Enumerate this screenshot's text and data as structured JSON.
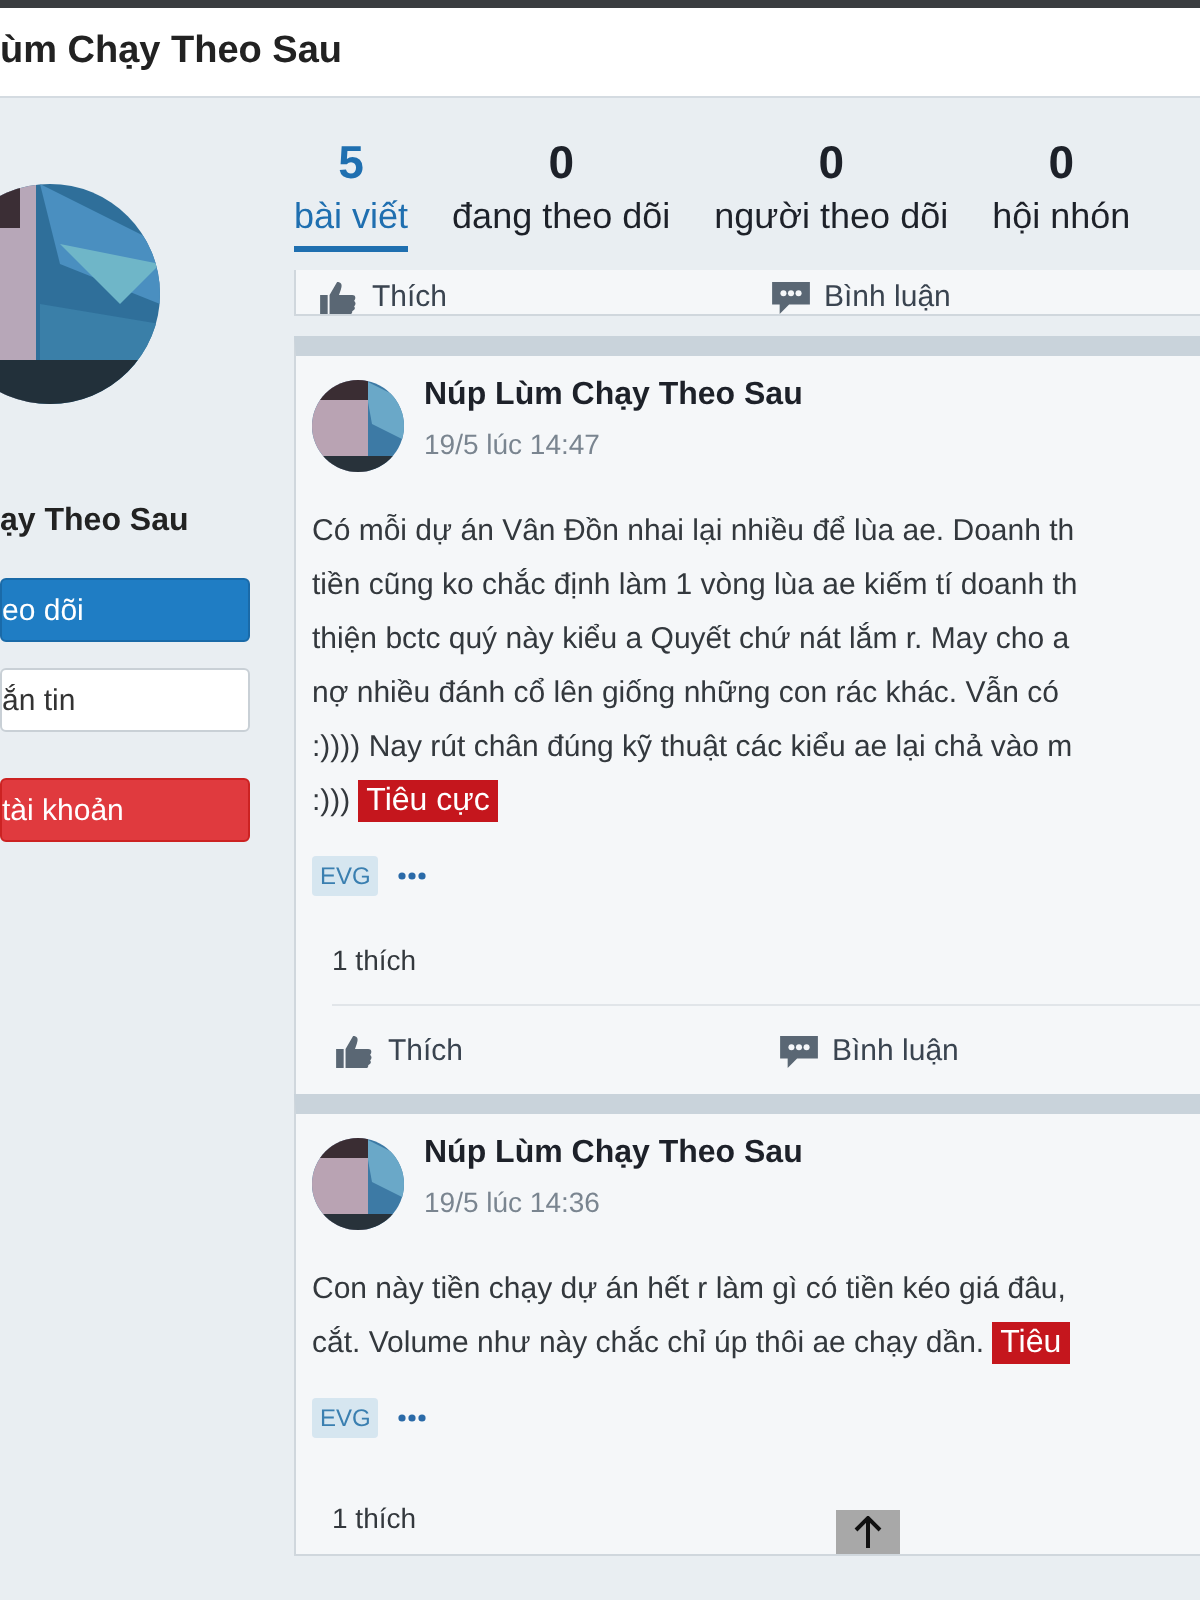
{
  "header": {
    "title": "ùm Chạy Theo Sau"
  },
  "profile": {
    "name": "ạy Theo Sau",
    "buttons": [
      {
        "label": "eo dõi",
        "kind": "primary"
      },
      {
        "label": "ắn tin",
        "kind": "default"
      },
      {
        "label": "tài khoản",
        "kind": "danger"
      }
    ]
  },
  "stats": [
    {
      "count": "5",
      "label": "bài viết",
      "selected": true
    },
    {
      "count": "0",
      "label": "đang theo dõi",
      "selected": false
    },
    {
      "count": "0",
      "label": "người theo dõi",
      "selected": false
    },
    {
      "count": "0",
      "label": "hội nhón",
      "selected": false
    }
  ],
  "partial_actions": [
    {
      "kind": "like",
      "label": "Thích"
    },
    {
      "kind": "comment",
      "label": "Bình luận"
    }
  ],
  "posts": [
    {
      "author": "Núp Lùm Chạy Theo Sau",
      "time": "19/5 lúc 14:47",
      "lines": [
        "Có mỗi dự án Vân Đồn nhai lại nhiều để lùa ae. Doanh th",
        "tiền cũng ko chắc định làm 1 vòng lùa ae kiếm tí doanh th",
        "thiện bctc quý này kiểu a Quyết chứ nát lắm r. May cho a",
        "nợ nhiều đánh cổ lên giống những con rác khác. Vẫn có",
        ":)))) Nay rút chân đúng kỹ thuật các kiểu ae lại chả vào m",
        ":)))"
      ],
      "sentiment": "Tiêu cực",
      "topics": [
        "EVG"
      ],
      "likes": "1 thích",
      "actions": [
        {
          "kind": "like",
          "label": "Thích"
        },
        {
          "kind": "comment",
          "label": "Bình luận"
        }
      ]
    },
    {
      "author": "Núp Lùm Chạy Theo Sau",
      "time": "19/5 lúc 14:36",
      "lines": [
        "Con này tiền chạy dự án hết r làm gì có tiền kéo giá đâu,",
        "cắt. Volume như này chắc chỉ úp thôi ae chạy dần."
      ],
      "sentiment": "Tiêu",
      "topics": [
        "EVG"
      ],
      "likes": "1 thích"
    }
  ]
}
